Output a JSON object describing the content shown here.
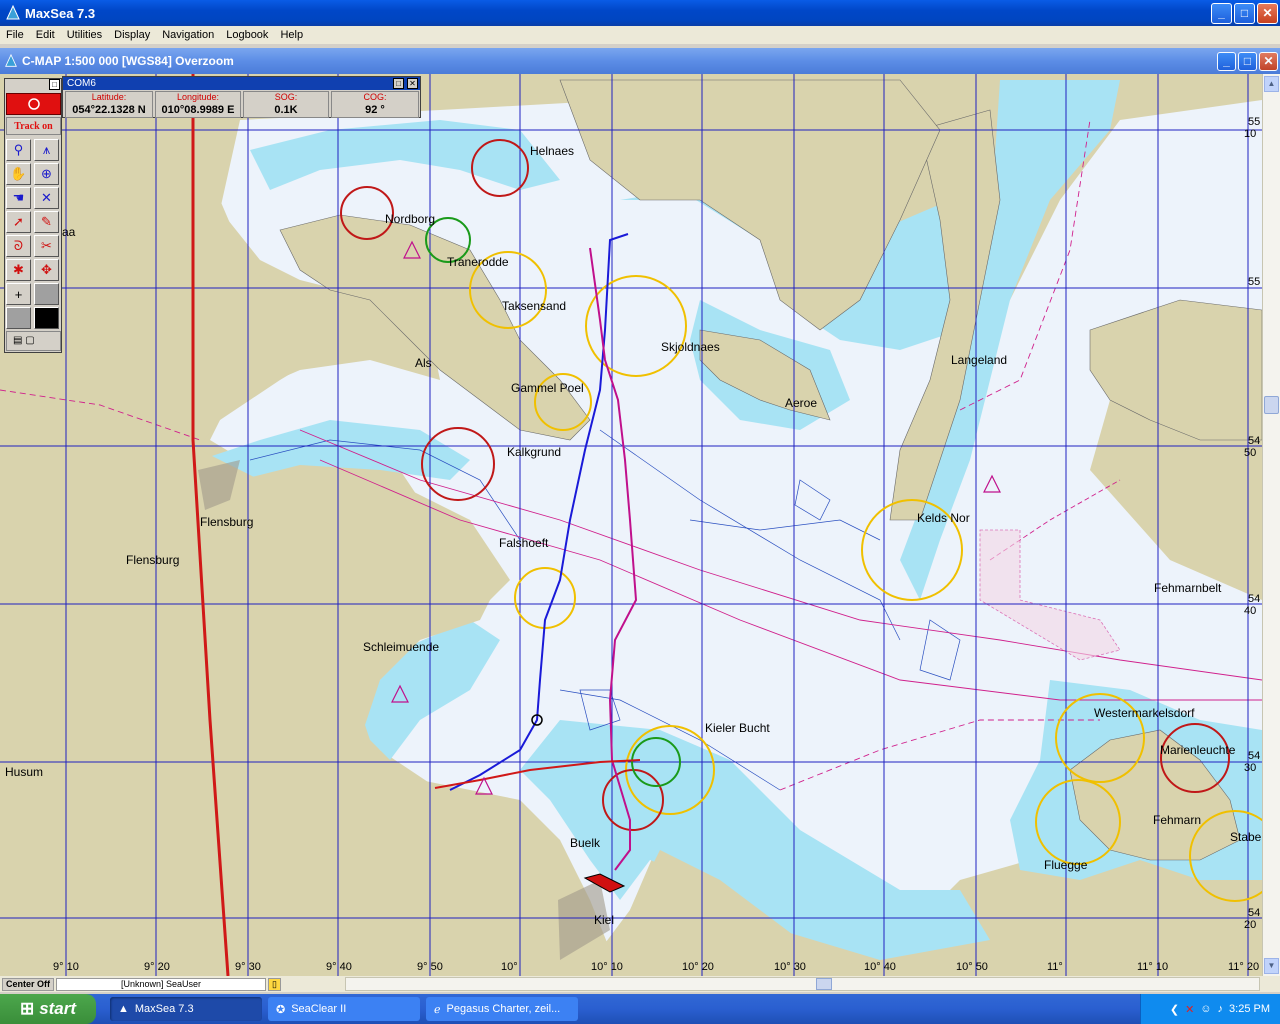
{
  "window": {
    "title": "MaxSea 7.3"
  },
  "menu": [
    "File",
    "Edit",
    "Utilities",
    "Display",
    "Navigation",
    "Logbook",
    "Help"
  ],
  "chart_window": {
    "title": "C-MAP  1:500 000 [WGS84]    Overzoom"
  },
  "com_panel": {
    "port": "COM6",
    "fields": [
      {
        "label": "Latitude:",
        "value": "054°22.1328 N"
      },
      {
        "label": "Longitude:",
        "value": "010°08.9989 E"
      },
      {
        "label": "SOG:",
        "value": "0.1K"
      },
      {
        "label": "COG:",
        "value": "92 °"
      }
    ]
  },
  "toolbox": {
    "track_label": "Track on"
  },
  "places": [
    "Helnaes",
    "Nordborg",
    "Tranerodde",
    "Taksensand",
    "Als",
    "Skjoldnaes",
    "Gammel Poel",
    "Langeland",
    "Aeroe",
    "Kalkgrund",
    "Flensburg",
    "Flensburg",
    "Falshoeft",
    "Kelds Nor",
    "Fehmarnbelt",
    "Schleimuende",
    "Westermarkelsdorf",
    "Marienleuchte",
    "Kieler Bucht",
    "Fehmarn",
    "Husum",
    "Buelk",
    "Kiel",
    "Fluegge",
    "Staber",
    "aa"
  ],
  "lon_labels": [
    "9° 10",
    "9° 20",
    "9° 30",
    "9° 40",
    "9° 50",
    "10°",
    "10° 10",
    "10° 20",
    "10° 30",
    "10° 40",
    "10° 50",
    "11°",
    "11° 10",
    "11° 20"
  ],
  "lat_labels": [
    "55",
    "10",
    "55",
    "54",
    "50",
    "54",
    "40",
    "54",
    "30",
    "54",
    "20"
  ],
  "statusbar": {
    "center": "Center Off",
    "user": "[Unknown] SeaUser"
  },
  "taskbar": {
    "start": "start",
    "tasks": [
      "MaxSea 7.3",
      "SeaClear II",
      "Pegasus Charter, zeil..."
    ],
    "clock": "3:25 PM"
  },
  "colors": {
    "land": "#d9d3ad",
    "shallow": "#a8e3f4",
    "deep": "#edf3fb",
    "grid": "#2020c0",
    "track_blue": "#1a1ad8",
    "track_magenta": "#c0108c",
    "red_line": "#d01818"
  }
}
